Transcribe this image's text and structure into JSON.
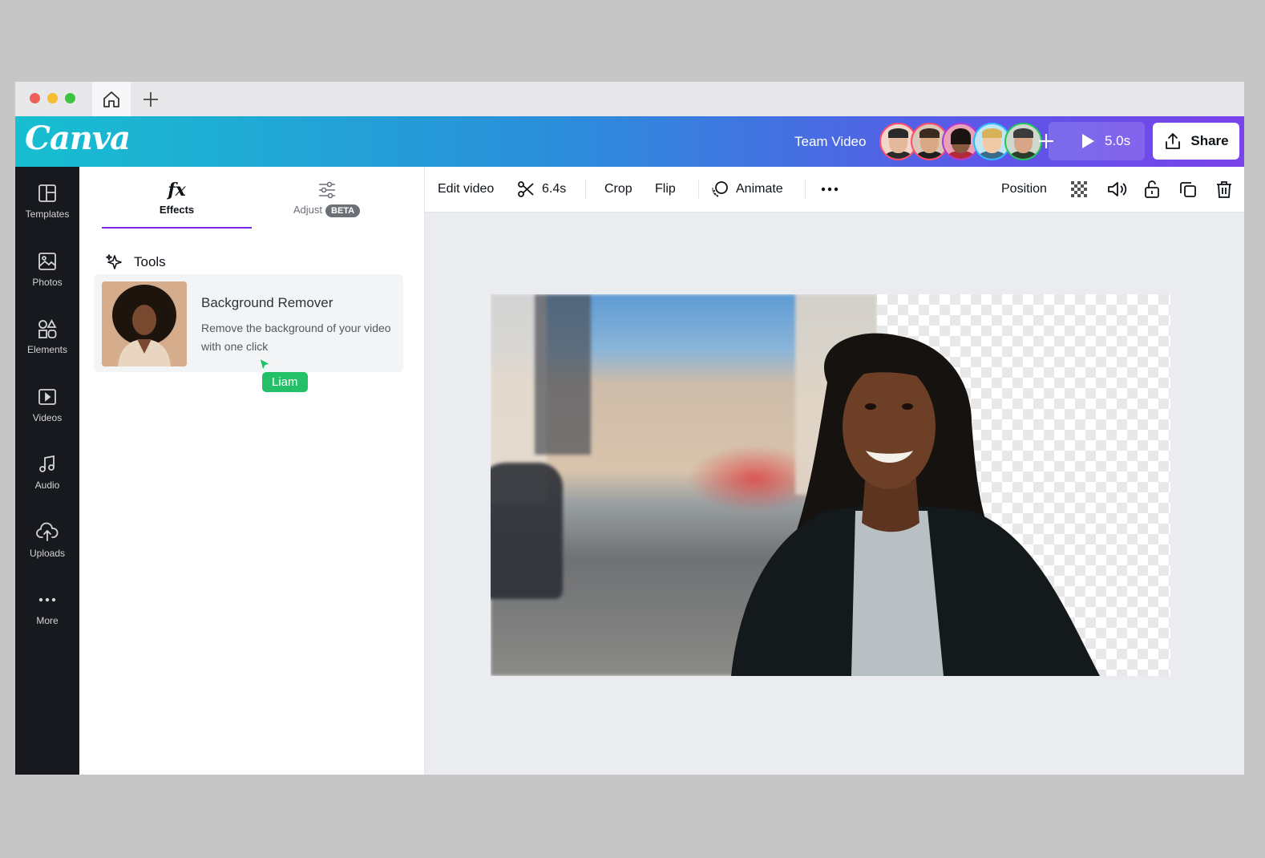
{
  "browser": {
    "home_tab_icon": "home-icon",
    "new_tab_icon": "plus-icon"
  },
  "header": {
    "logo": "Canva",
    "team_name": "Team Video",
    "avatars": [
      {
        "name": "collaborator-1",
        "ring": "#ff4d6d"
      },
      {
        "name": "collaborator-2",
        "ring": "#ff4d6d"
      },
      {
        "name": "collaborator-3",
        "ring": "#b03ad6"
      },
      {
        "name": "collaborator-4",
        "ring": "#2fb7ff"
      },
      {
        "name": "collaborator-5",
        "ring": "#22c55e"
      }
    ],
    "play_duration": "5.0s",
    "share_label": "Share"
  },
  "leftbar": {
    "items": [
      {
        "label": "Templates",
        "icon": "templates-icon"
      },
      {
        "label": "Photos",
        "icon": "photos-icon"
      },
      {
        "label": "Elements",
        "icon": "elements-icon"
      },
      {
        "label": "Videos",
        "icon": "videos-icon"
      },
      {
        "label": "Audio",
        "icon": "audio-icon"
      },
      {
        "label": "Uploads",
        "icon": "uploads-icon"
      },
      {
        "label": "More",
        "icon": "more-icon"
      }
    ]
  },
  "panel": {
    "tabs": [
      {
        "label": "Effects",
        "glyph": "fx",
        "active": true
      },
      {
        "label": "Adjust",
        "badge": "BETA",
        "active": false
      }
    ],
    "section_title": "Tools",
    "tool": {
      "title": "Background Remover",
      "description": "Remove the background of your video with one click"
    },
    "cursor_label": "Liam"
  },
  "toolbar": {
    "edit_video": "Edit video",
    "trim_duration": "6.4s",
    "crop": "Crop",
    "flip": "Flip",
    "animate": "Animate",
    "position": "Position"
  },
  "colors": {
    "accent": "#7d2ae8",
    "cursor_tag": "#23c068",
    "sidebar_bg": "#17191e"
  }
}
